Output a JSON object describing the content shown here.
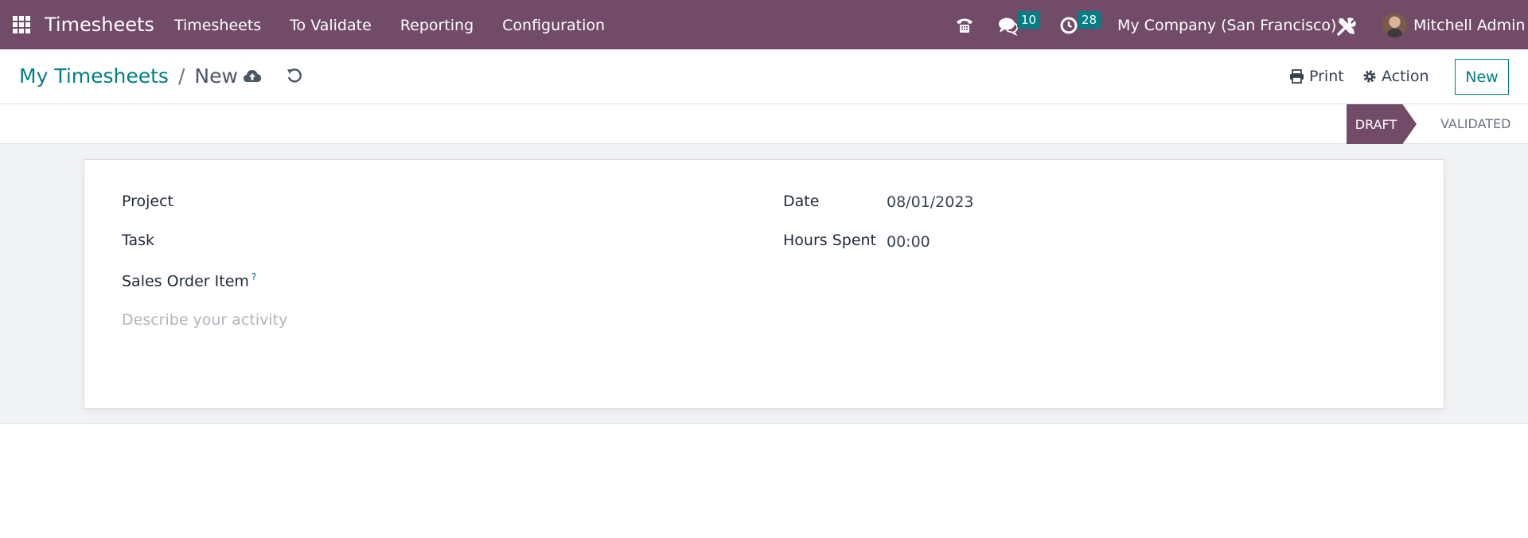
{
  "navbar": {
    "app_name": "Timesheets",
    "menu": [
      {
        "label": "Timesheets"
      },
      {
        "label": "To Validate"
      },
      {
        "label": "Reporting"
      },
      {
        "label": "Configuration"
      }
    ],
    "messages_count": "10",
    "activities_count": "28",
    "company": "My Company (San Francisco)",
    "user": "Mitchell Admin",
    "bg_color": "#714b67",
    "badge_color": "#017e84"
  },
  "control_panel": {
    "breadcrumb_parent": "My Timesheets",
    "breadcrumb_separator": "/",
    "breadcrumb_current": "New",
    "print_label": "Print",
    "action_label": "Action",
    "new_label": "New"
  },
  "statusbar": {
    "stages": [
      "DRAFT",
      "VALIDATED"
    ],
    "current": "DRAFT"
  },
  "form": {
    "project_label": "Project",
    "project_value": "",
    "task_label": "Task",
    "task_value": "",
    "sales_order_item_label": "Sales Order Item",
    "sales_order_item_help": "?",
    "description_placeholder": "Describe your activity",
    "date_label": "Date",
    "date_value": "08/01/2023",
    "hours_spent_label": "Hours Spent",
    "hours_spent_value": "00:00"
  },
  "icons": {
    "apps": "apps-grid-icon",
    "phone": "phone-icon",
    "chat": "chat-icon",
    "activity": "clock-icon",
    "tools": "tools-icon",
    "save": "cloud-upload-icon",
    "discard": "undo-icon",
    "print": "printer-icon",
    "action": "gear-icon"
  }
}
